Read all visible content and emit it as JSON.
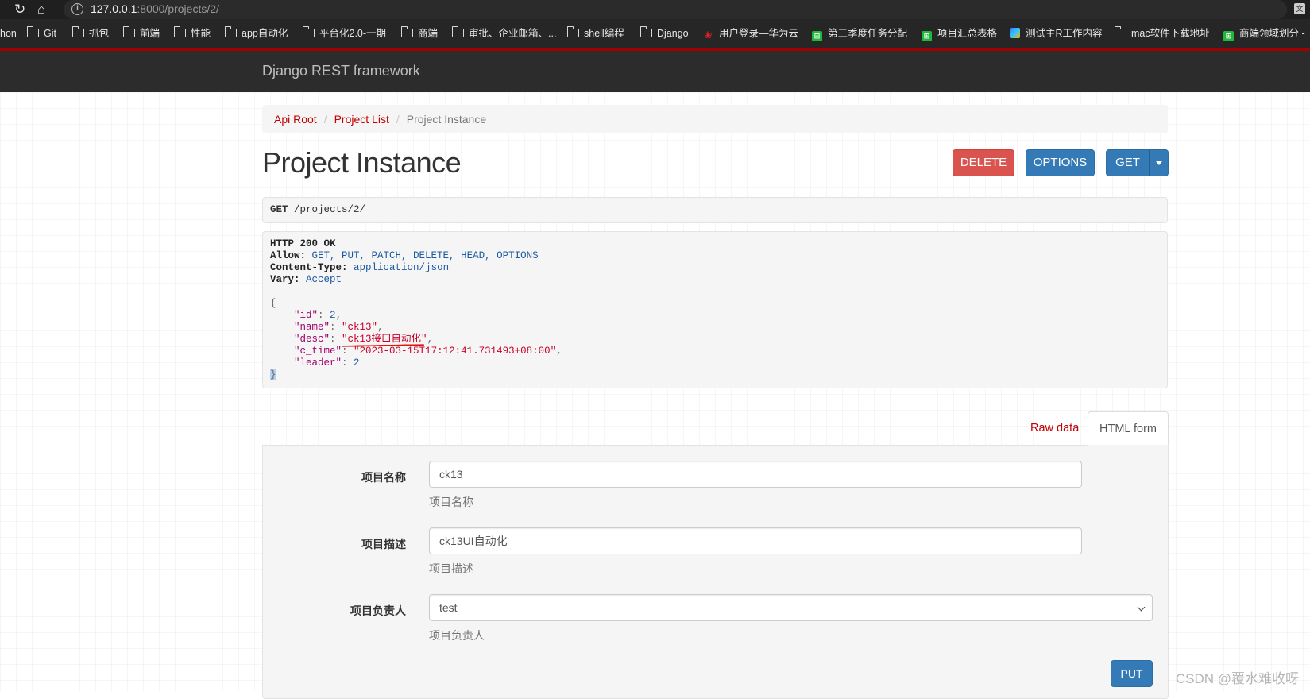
{
  "browser": {
    "url_host": "127.0.0.1",
    "url_path": ":8000/projects/2/",
    "bookmarks": [
      {
        "label": "hon",
        "icon": "none"
      },
      {
        "label": "Git",
        "icon": "folder"
      },
      {
        "label": "抓包",
        "icon": "folder"
      },
      {
        "label": "前端",
        "icon": "folder"
      },
      {
        "label": "性能",
        "icon": "folder"
      },
      {
        "label": "app自动化",
        "icon": "folder"
      },
      {
        "label": "平台化2.0-一期",
        "icon": "folder"
      },
      {
        "label": "商端",
        "icon": "folder"
      },
      {
        "label": "审批、企业邮箱、...",
        "icon": "folder"
      },
      {
        "label": "shell编程",
        "icon": "folder"
      },
      {
        "label": "Django",
        "icon": "folder"
      },
      {
        "label": "用户登录—华为云",
        "icon": "huawei"
      },
      {
        "label": "第三季度任务分配",
        "icon": "sheet"
      },
      {
        "label": "项目汇总表格",
        "icon": "sheet"
      },
      {
        "label": "测试主R工作内容",
        "icon": "doc"
      },
      {
        "label": "mac软件下载地址",
        "icon": "folder"
      },
      {
        "label": "商端领域划分 -",
        "icon": "sheet"
      }
    ]
  },
  "navbar": {
    "brand": "Django REST framework"
  },
  "breadcrumb": {
    "items": [
      {
        "label": "Api Root"
      },
      {
        "label": "Project List"
      }
    ],
    "active": "Project Instance"
  },
  "page": {
    "title": "Project Instance"
  },
  "actions": {
    "delete": "DELETE",
    "options": "OPTIONS",
    "get": "GET"
  },
  "request": {
    "method": "GET",
    "path": "/projects/2/"
  },
  "response": {
    "status": "HTTP 200 OK",
    "headers": [
      {
        "key": "Allow:",
        "value": "GET, PUT, PATCH, DELETE, HEAD, OPTIONS"
      },
      {
        "key": "Content-Type:",
        "value": "application/json"
      },
      {
        "key": "Vary:",
        "value": "Accept"
      }
    ],
    "body": {
      "id": "2",
      "name": "\"ck13\"",
      "desc": "\"ck13接口自动化\"",
      "c_time": "\"2023-03-15T17:12:41.731493+08:00\"",
      "leader": "2"
    }
  },
  "tabs": {
    "raw": "Raw data",
    "html": "HTML form"
  },
  "form": {
    "name": {
      "label": "项目名称",
      "value": "ck13",
      "help": "项目名称"
    },
    "desc": {
      "label": "项目描述",
      "value": "ck13UI自动化",
      "help": "项目描述"
    },
    "leader": {
      "label": "项目负责人",
      "value": "test",
      "help": "项目负责人"
    },
    "submit": "PUT"
  },
  "accent_colors": {
    "link": "#c20000",
    "primary": "#337ab7",
    "danger": "#d9534f",
    "annotation": "#e3140f"
  },
  "watermark": "CSDN @覆水难收呀"
}
